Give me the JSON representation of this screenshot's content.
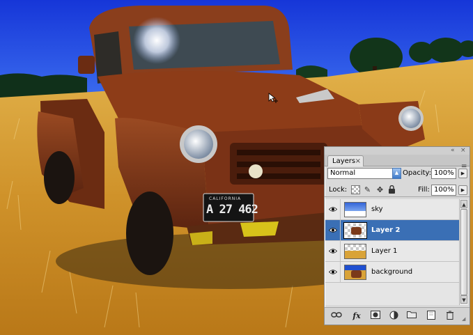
{
  "canvas": {
    "photo": {
      "subject": "truck-photo",
      "plate_state": "CALIFORNIA",
      "plate_number": "A 27 462"
    },
    "colors": {
      "sky": "#1f3fe0",
      "field": "#d69a2f",
      "truck_body": "#7a3417",
      "trees": "#123218"
    }
  },
  "layers_panel": {
    "tab_label": "Layers",
    "tab_close": "×",
    "chrome": {
      "minimize": "«",
      "close": "×"
    },
    "menu_icon": "☰",
    "blend_mode": "Normal",
    "opacity_label": "Opacity:",
    "opacity_value": "100%",
    "lock_label": "Lock:",
    "fill_label": "Fill:",
    "fill_value": "100%",
    "layers": [
      {
        "name": "sky",
        "visible": true,
        "selected": false,
        "thumb": "sky-thumbnail"
      },
      {
        "name": "Layer 2",
        "visible": true,
        "selected": true,
        "thumb": "truck-thumbnail"
      },
      {
        "name": "Layer 1",
        "visible": true,
        "selected": false,
        "thumb": "field-thumbnail"
      },
      {
        "name": "background",
        "visible": true,
        "selected": false,
        "thumb": "background-thumbnail"
      }
    ],
    "bottom_icons": [
      "link-icon",
      "fx-icon",
      "mask-icon",
      "adjustment-icon",
      "group-folder-icon",
      "new-layer-icon",
      "trash-icon"
    ],
    "fx_label": "fx",
    "selection_color": "#3a6fb5"
  }
}
